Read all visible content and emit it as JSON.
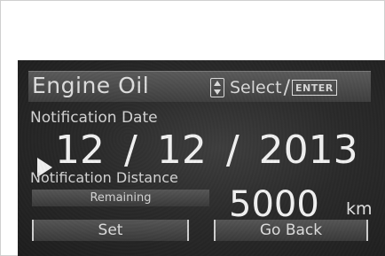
{
  "header": {
    "title": "Engine Oil",
    "select_label": "Select",
    "separator": "/",
    "enter_label": "ENTER"
  },
  "notification_date": {
    "label": "Notification Date",
    "month": "12",
    "day": "12",
    "year": "2013",
    "separator": "/"
  },
  "notification_distance": {
    "label": "Notification Distance",
    "remaining_label": "Remaining",
    "value": "5000",
    "unit": "km"
  },
  "buttons": {
    "set_label": "Set",
    "go_back_label": "Go Back"
  },
  "icons": {
    "updown": "updown-arrows-icon",
    "cursor": "right-triangle-cursor-icon"
  },
  "colors": {
    "screen_bg": "#2a2a2a",
    "bar_bg": "#4a4a4a",
    "text_primary": "#f2f2f2",
    "text_secondary": "#d4d4d4"
  }
}
